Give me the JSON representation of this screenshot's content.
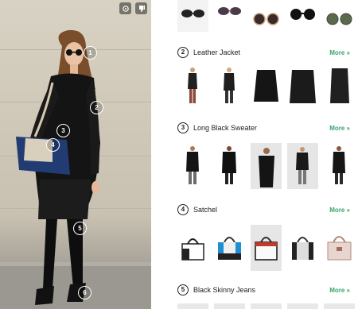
{
  "photo": {
    "tags": [
      "1",
      "2",
      "3",
      "4",
      "5",
      "6"
    ]
  },
  "sections": [
    {
      "number": "2",
      "title": "Leather Jacket",
      "more": "More »"
    },
    {
      "number": "3",
      "title": "Long Black Sweater",
      "more": "More »"
    },
    {
      "number": "4",
      "title": "Satchel",
      "more": "More »"
    },
    {
      "number": "5",
      "title": "Black Skinny Jeans",
      "more": "More »"
    }
  ],
  "icons": {
    "share": "share-icon",
    "dislike": "thumbs-down-icon"
  }
}
